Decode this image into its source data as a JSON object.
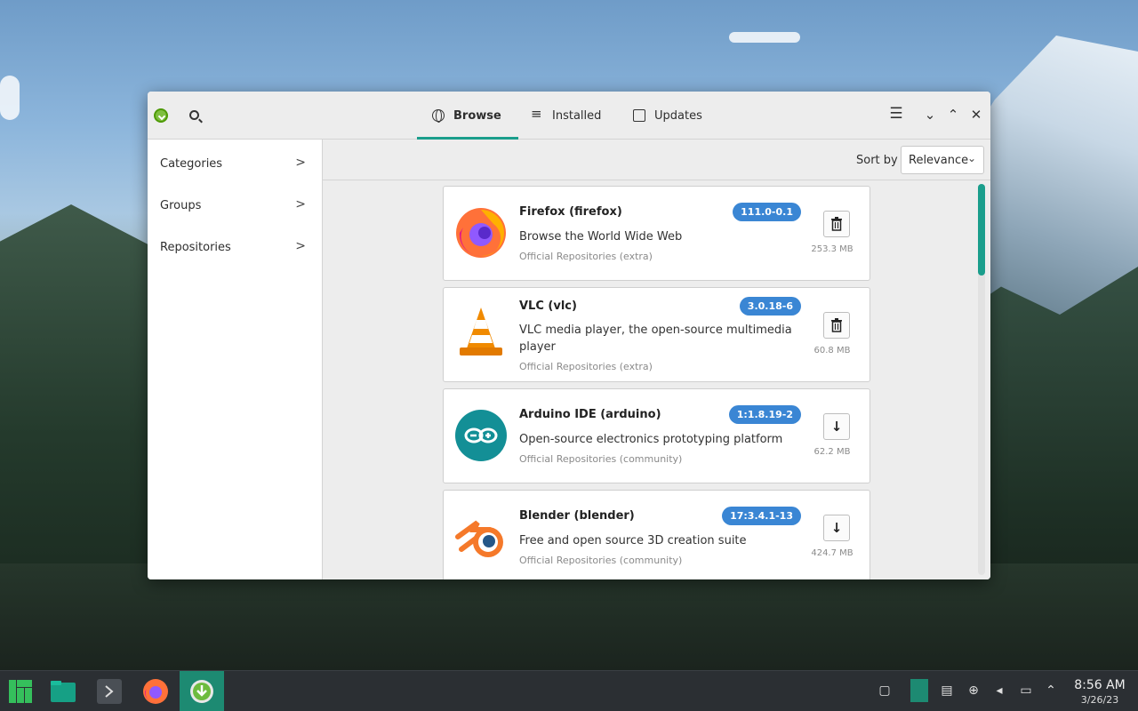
{
  "window": {
    "tabs": [
      {
        "label": "Browse",
        "icon": "globe-icon",
        "active": true
      },
      {
        "label": "Installed",
        "icon": "list-icon",
        "active": false
      },
      {
        "label": "Updates",
        "icon": "updates-icon",
        "active": false
      }
    ],
    "accent_color": "#1a9e8c"
  },
  "sidebar": {
    "items": [
      {
        "label": "Categories"
      },
      {
        "label": "Groups"
      },
      {
        "label": "Repositories"
      }
    ]
  },
  "sort": {
    "label": "Sort by",
    "selected": "Relevance"
  },
  "packages": [
    {
      "name": "Firefox (firefox)",
      "description": "Browse the World Wide Web",
      "repository": "Official Repositories (extra)",
      "version": "111.0-0.1",
      "size": "253.3 MB",
      "action": "remove",
      "action_icon": "trash-icon"
    },
    {
      "name": "VLC (vlc)",
      "description": "VLC media player, the open-source multimedia player",
      "repository": "Official Repositories (extra)",
      "version": "3.0.18-6",
      "size": "60.8 MB",
      "action": "remove",
      "action_icon": "trash-icon"
    },
    {
      "name": "Arduino IDE (arduino)",
      "description": "Open-source electronics prototyping platform",
      "repository": "Official Repositories (community)",
      "version": "1:1.8.19-2",
      "size": "62.2 MB",
      "action": "install",
      "action_icon": "download-icon"
    },
    {
      "name": "Blender (blender)",
      "description": "Free and open source 3D creation suite",
      "repository": "Official Repositories (community)",
      "version": "17:3.4.1-13",
      "size": "424.7 MB",
      "action": "install",
      "action_icon": "download-icon"
    }
  ],
  "version_badge_color": "#3a86d4",
  "taskbar": {
    "time": "8:56 AM",
    "date": "3/26/23"
  }
}
